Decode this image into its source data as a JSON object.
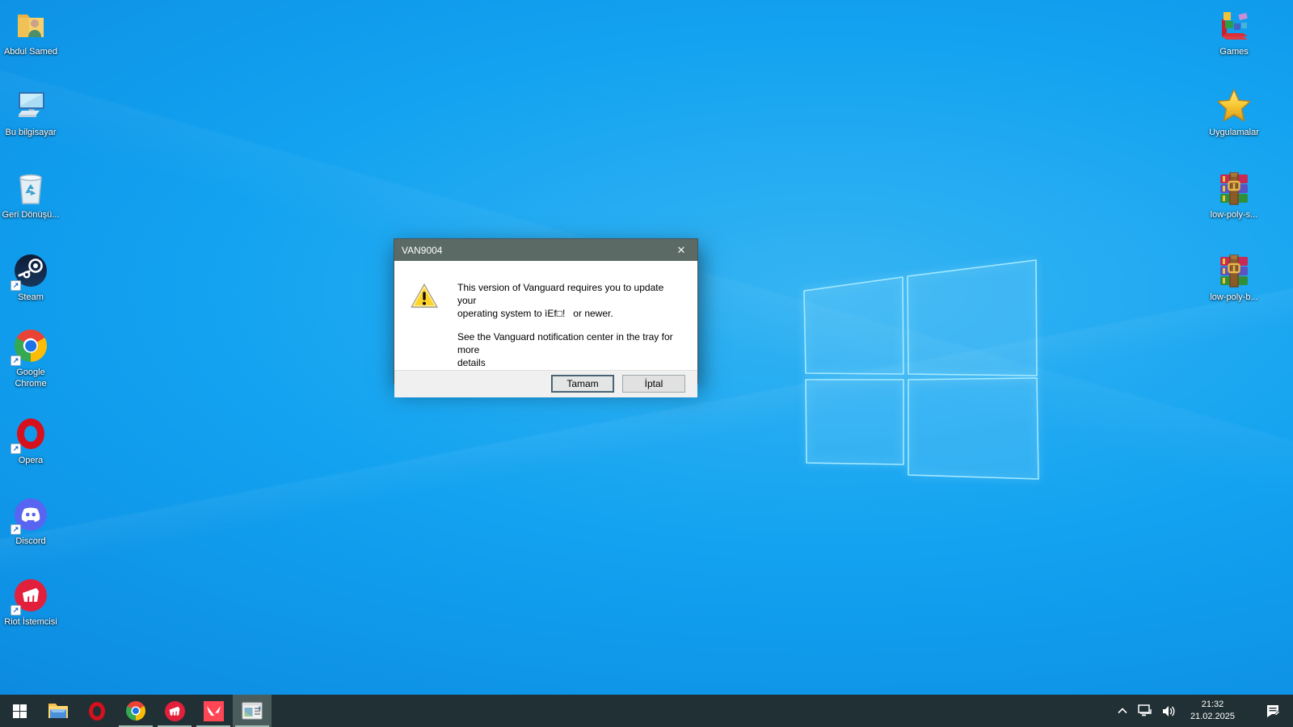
{
  "colors": {
    "wallpaper_base": "#12a2f0",
    "dialog_titlebar": "#5b6a65",
    "taskbar": "#213034",
    "taskbar_active_item": "#4a5d5c",
    "taskbar_running_indicator": "#9fbcb4",
    "warning_yellow": "#ffd42a"
  },
  "desktop_icons": {
    "left": [
      {
        "name": "user-folder",
        "label": "Abdul Samed"
      },
      {
        "name": "this-pc",
        "label": "Bu bilgisayar"
      },
      {
        "name": "recycle-bin",
        "label": "Geri Dönüşü..."
      },
      {
        "name": "steam",
        "label": "Steam"
      },
      {
        "name": "chrome",
        "label": "Google Chrome"
      },
      {
        "name": "opera",
        "label": "Opera"
      },
      {
        "name": "discord",
        "label": "Discord"
      },
      {
        "name": "riot-client",
        "label": "Riot İstemcisi"
      }
    ],
    "right": [
      {
        "name": "games-folder",
        "label": "Games"
      },
      {
        "name": "apps-star",
        "label": "Uygulamalar"
      },
      {
        "name": "winrar-archive-1",
        "label": "low-poly-s..."
      },
      {
        "name": "winrar-archive-2",
        "label": "low-poly-b..."
      }
    ]
  },
  "dialog": {
    "title": "VAN9004",
    "close_glyph": "✕",
    "message": {
      "para1_line1": "This version of Vanguard requires you to update your",
      "para1_line2": "operating system to ìEf□!   or newer.",
      "para2_line1": "See the Vanguard notification center in the tray for more",
      "para2_line2": "details"
    },
    "buttons": {
      "ok": "Tamam",
      "cancel": "İptal"
    }
  },
  "taskbar": {
    "items": [
      {
        "name": "start-button"
      },
      {
        "name": "file-explorer"
      },
      {
        "name": "opera"
      },
      {
        "name": "chrome",
        "running": true
      },
      {
        "name": "riot-client",
        "running": true
      },
      {
        "name": "valorant",
        "running": true
      },
      {
        "name": "van9004-window",
        "running": true,
        "active": true
      }
    ],
    "tray": {
      "chevron": "hidden-icons",
      "network": "ethernet-network",
      "volume": "speaker",
      "time": "21:32",
      "date": "21.02.2025",
      "action_center": "notifications"
    }
  }
}
